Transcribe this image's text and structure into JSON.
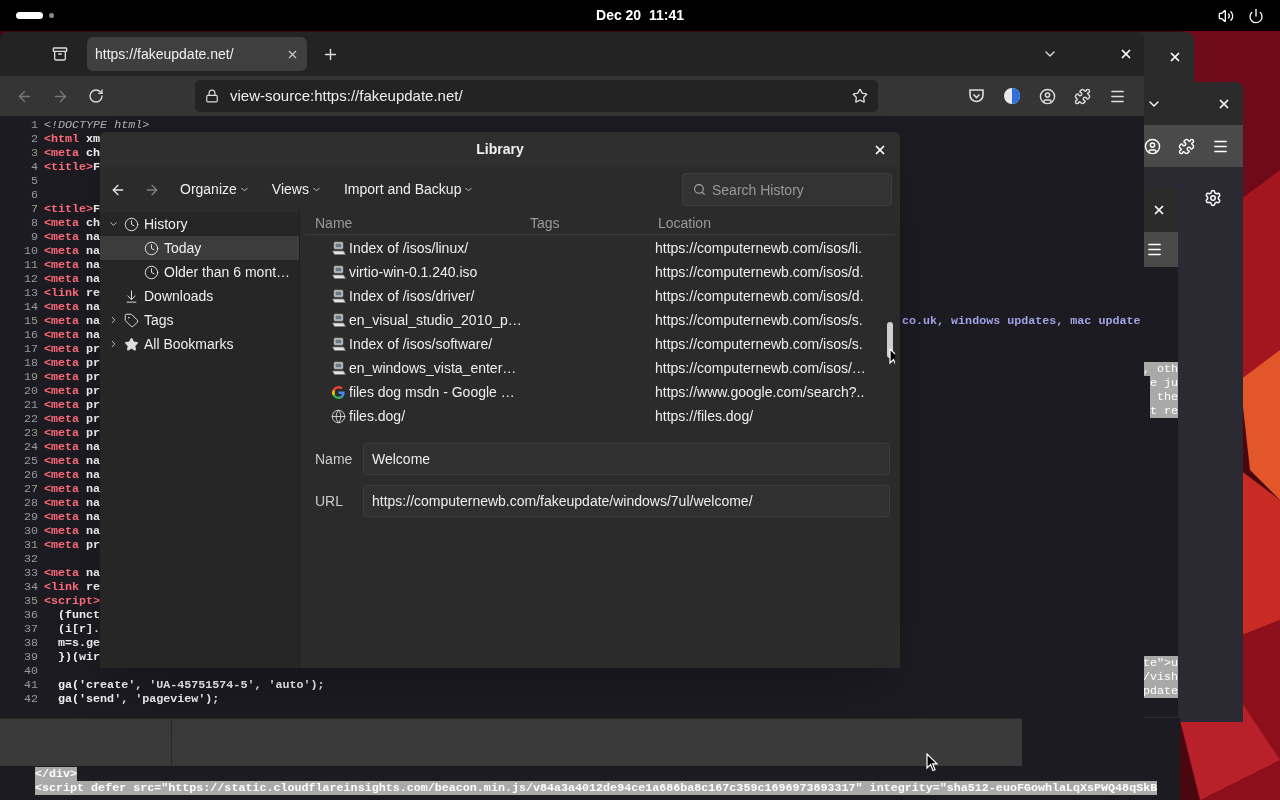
{
  "top_bar": {
    "clock": "Dec 20  11:41"
  },
  "browser": {
    "tabs": [
      {
        "title": "https://fakeupdate.net/",
        "selected": true
      }
    ],
    "address": "view-source:https://fakeupdate.net/",
    "source_lines": [
      {
        "number": "1",
        "parts": [
          {
            "kind": "doctype",
            "text": "<!DOCTYPE html>"
          }
        ]
      },
      {
        "number": "2",
        "parts": [
          {
            "kind": "tag",
            "text": "<html"
          },
          {
            "kind": "text",
            "text": " xm"
          }
        ]
      },
      {
        "number": "3",
        "parts": [
          {
            "kind": "tag",
            "text": "<meta"
          },
          {
            "kind": "text",
            "text": " ch"
          }
        ]
      },
      {
        "number": "4",
        "parts": [
          {
            "kind": "tag",
            "text": "<title>"
          },
          {
            "kind": "text",
            "text": "F"
          }
        ]
      },
      {
        "number": "5"
      },
      {
        "number": "6"
      },
      {
        "number": "7",
        "parts": [
          {
            "kind": "tag",
            "text": "<title>"
          },
          {
            "kind": "text",
            "text": "F"
          }
        ]
      },
      {
        "number": "8",
        "parts": [
          {
            "kind": "tag",
            "text": "<meta"
          },
          {
            "kind": "text",
            "text": " ch"
          }
        ]
      },
      {
        "number": "9",
        "parts": [
          {
            "kind": "tag",
            "text": "<meta"
          },
          {
            "kind": "text",
            "text": " na"
          }
        ]
      },
      {
        "number": "10",
        "parts": [
          {
            "kind": "tag",
            "text": "<meta"
          },
          {
            "kind": "text",
            "text": " na"
          }
        ]
      },
      {
        "number": "11",
        "parts": [
          {
            "kind": "tag",
            "text": "<meta"
          },
          {
            "kind": "text",
            "text": " na"
          }
        ]
      },
      {
        "number": "12",
        "parts": [
          {
            "kind": "tag",
            "text": "<meta"
          },
          {
            "kind": "text",
            "text": " na"
          }
        ]
      },
      {
        "number": "13",
        "parts": [
          {
            "kind": "tag",
            "text": "<link"
          },
          {
            "kind": "text",
            "text": " re"
          }
        ]
      },
      {
        "number": "14",
        "parts": [
          {
            "kind": "tag",
            "text": "<meta"
          },
          {
            "kind": "text",
            "text": " na"
          }
        ]
      },
      {
        "number": "15",
        "parts": [
          {
            "kind": "tag",
            "text": "<meta"
          },
          {
            "kind": "text",
            "text": " na"
          }
        ]
      },
      {
        "number": "16",
        "parts": [
          {
            "kind": "tag",
            "text": "<meta"
          },
          {
            "kind": "text",
            "text": " na"
          }
        ]
      },
      {
        "number": "17",
        "parts": [
          {
            "kind": "tag",
            "text": "<meta"
          },
          {
            "kind": "text",
            "text": " pr"
          }
        ]
      },
      {
        "number": "18",
        "parts": [
          {
            "kind": "tag",
            "text": "<meta"
          },
          {
            "kind": "text",
            "text": " pr"
          }
        ]
      },
      {
        "number": "19",
        "parts": [
          {
            "kind": "tag",
            "text": "<meta"
          },
          {
            "kind": "text",
            "text": " pr"
          }
        ]
      },
      {
        "number": "20",
        "parts": [
          {
            "kind": "tag",
            "text": "<meta"
          },
          {
            "kind": "text",
            "text": " pr"
          }
        ]
      },
      {
        "number": "21",
        "parts": [
          {
            "kind": "tag",
            "text": "<meta"
          },
          {
            "kind": "text",
            "text": " pr"
          }
        ]
      },
      {
        "number": "22",
        "parts": [
          {
            "kind": "tag",
            "text": "<meta"
          },
          {
            "kind": "text",
            "text": " pr"
          }
        ]
      },
      {
        "number": "23",
        "parts": [
          {
            "kind": "tag",
            "text": "<meta"
          },
          {
            "kind": "text",
            "text": " pr"
          }
        ]
      },
      {
        "number": "24",
        "parts": [
          {
            "kind": "tag",
            "text": "<meta"
          },
          {
            "kind": "text",
            "text": " na"
          }
        ]
      },
      {
        "number": "25",
        "parts": [
          {
            "kind": "tag",
            "text": "<meta"
          },
          {
            "kind": "text",
            "text": " na"
          }
        ]
      },
      {
        "number": "26",
        "parts": [
          {
            "kind": "tag",
            "text": "<meta"
          },
          {
            "kind": "text",
            "text": " na"
          }
        ]
      },
      {
        "number": "27",
        "parts": [
          {
            "kind": "tag",
            "text": "<meta"
          },
          {
            "kind": "text",
            "text": " na"
          }
        ]
      },
      {
        "number": "28",
        "parts": [
          {
            "kind": "tag",
            "text": "<meta"
          },
          {
            "kind": "text",
            "text": " na"
          }
        ]
      },
      {
        "number": "29",
        "parts": [
          {
            "kind": "tag",
            "text": "<meta"
          },
          {
            "kind": "text",
            "text": " na"
          }
        ]
      },
      {
        "number": "30",
        "parts": [
          {
            "kind": "tag",
            "text": "<meta"
          },
          {
            "kind": "text",
            "text": " na"
          }
        ]
      },
      {
        "number": "31",
        "parts": [
          {
            "kind": "tag",
            "text": "<meta"
          },
          {
            "kind": "text",
            "text": " pr"
          }
        ]
      },
      {
        "number": "32"
      },
      {
        "number": "33",
        "parts": [
          {
            "kind": "tag",
            "text": "<meta"
          },
          {
            "kind": "text",
            "text": " na"
          }
        ]
      },
      {
        "number": "34",
        "parts": [
          {
            "kind": "tag",
            "text": "<link"
          },
          {
            "kind": "text",
            "text": " re"
          }
        ]
      },
      {
        "number": "35",
        "parts": [
          {
            "kind": "tag",
            "text": "<script>"
          }
        ]
      },
      {
        "number": "36",
        "parts": [
          {
            "kind": "text",
            "text": "  (funct"
          }
        ]
      },
      {
        "number": "37",
        "parts": [
          {
            "kind": "text",
            "text": "  (i[r]."
          }
        ]
      },
      {
        "number": "38",
        "parts": [
          {
            "kind": "text",
            "text": "  m=s.ge"
          }
        ]
      },
      {
        "number": "39",
        "parts": [
          {
            "kind": "text",
            "text": "  })(wir"
          }
        ]
      },
      {
        "number": "40"
      },
      {
        "number": "41",
        "parts": [
          {
            "kind": "text",
            "text": "  ga('create', 'UA-45751574-5', 'auto');"
          }
        ]
      },
      {
        "number": "42",
        "parts": [
          {
            "kind": "text",
            "text": "  ga('send', 'pageview');"
          }
        ]
      }
    ],
    "source_tail": "co.uk, windows updates, mac update"
  },
  "back_windows": {
    "highlighted_upper": [
      ", oth",
      "e ju",
      " the",
      "t re"
    ],
    "highlighted_lower": [
      "te\">u",
      "/vish",
      "pdate"
    ]
  },
  "bottom_source": [
    "</div>",
    "<script defer src=\"https://static.cloudflareinsights.com/beacon.min.js/v84a3a4012de94ce1a686ba8c167c359c1696973893317\" integrity=\"sha512-euoFGowhlaLqXsPWQ48qSkB"
  ],
  "library": {
    "title": "Library",
    "menus": [
      "Organize",
      "Views",
      "Import and Backup"
    ],
    "search": {
      "placeholder": "Search History"
    },
    "sidebar": [
      {
        "kind": "history",
        "label": "History",
        "expanded": true,
        "selected": false,
        "children": [
          {
            "kind": "day",
            "label": "Today",
            "selected": true
          },
          {
            "kind": "day",
            "label": "Older than 6 mont…",
            "selected": false
          }
        ]
      },
      {
        "kind": "downloads",
        "label": "Downloads",
        "selected": false
      },
      {
        "kind": "tags",
        "label": "Tags",
        "expanded": false,
        "selected": false
      },
      {
        "kind": "bookmarks",
        "label": "All Bookmarks",
        "expanded": false,
        "selected": false
      }
    ],
    "columns": [
      "Name",
      "Tags",
      "Location"
    ],
    "rows": [
      {
        "kind": "computer",
        "name": "Index of /isos/linux/",
        "location": "https://computernewb.com/isos/li.",
        "selected": false
      },
      {
        "kind": "computer",
        "name": "virtio-win-0.1.240.iso",
        "location": "https://computernewb.com/isos/d.",
        "selected": false
      },
      {
        "kind": "computer",
        "name": "Index of /isos/driver/",
        "location": "https://computernewb.com/isos/d.",
        "selected": false
      },
      {
        "kind": "computer",
        "name": "en_visual_studio_2010_p…",
        "location": "https://computernewb.com/isos/s.",
        "selected": false
      },
      {
        "kind": "computer",
        "name": "Index of /isos/software/",
        "location": "https://computernewb.com/isos/s.",
        "selected": false
      },
      {
        "kind": "computer",
        "name": "en_windows_vista_enter…",
        "location": "https://computernewb.com/isos/…",
        "selected": false
      },
      {
        "kind": "google",
        "name": "files dog msdn - Google …",
        "location": "https://www.google.com/search?..",
        "selected": false
      },
      {
        "kind": "globe",
        "name": "files.dog/",
        "location": "https://files.dog/",
        "selected": false
      }
    ],
    "details": {
      "name_label": "Name",
      "name_value": "Welcome",
      "url_label": "URL",
      "url_value": "https://computernewb.com/fakeupdate/windows/7ul/welcome/"
    }
  }
}
